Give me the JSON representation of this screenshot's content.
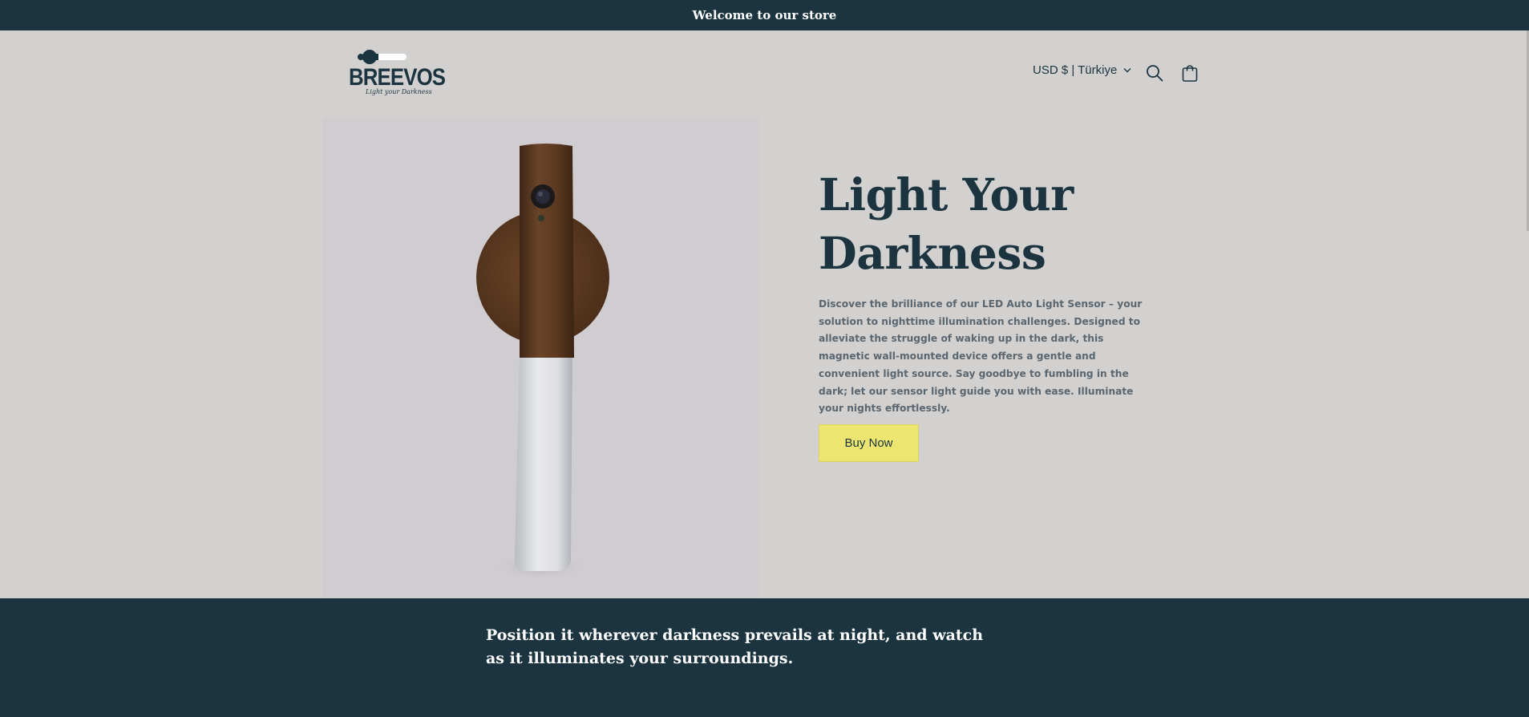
{
  "announcement": {
    "text": "Welcome to our store"
  },
  "header": {
    "logo": {
      "brand": "BREEVOS",
      "tagline": "Light your Darkness"
    },
    "currency_label": "USD $ | Türkiye",
    "icons": [
      "chevron-down-icon",
      "search-icon",
      "cart-icon"
    ]
  },
  "hero": {
    "title_line1": "Light Your",
    "title_line2": "Darkness",
    "description": "Discover the brilliance of our LED Auto Light Sensor – your solution to nighttime illumination challenges. Designed to alleviate the struggle of waking up in the dark, this magnetic wall-mounted device offers a gentle and convenient light source. Say goodbye to fumbling in the dark; let our sensor light guide you with ease. Illuminate your nights effortlessly.",
    "button_label": "Buy Now"
  },
  "band": {
    "text": "Position it wherever darkness prevails at night, and watch as it illuminates your surroundings."
  },
  "colors": {
    "brand_dark": "#1b3440",
    "page_bg": "#d3d1cf",
    "button_bg": "#ece56f",
    "wood": "#5e3a22"
  }
}
